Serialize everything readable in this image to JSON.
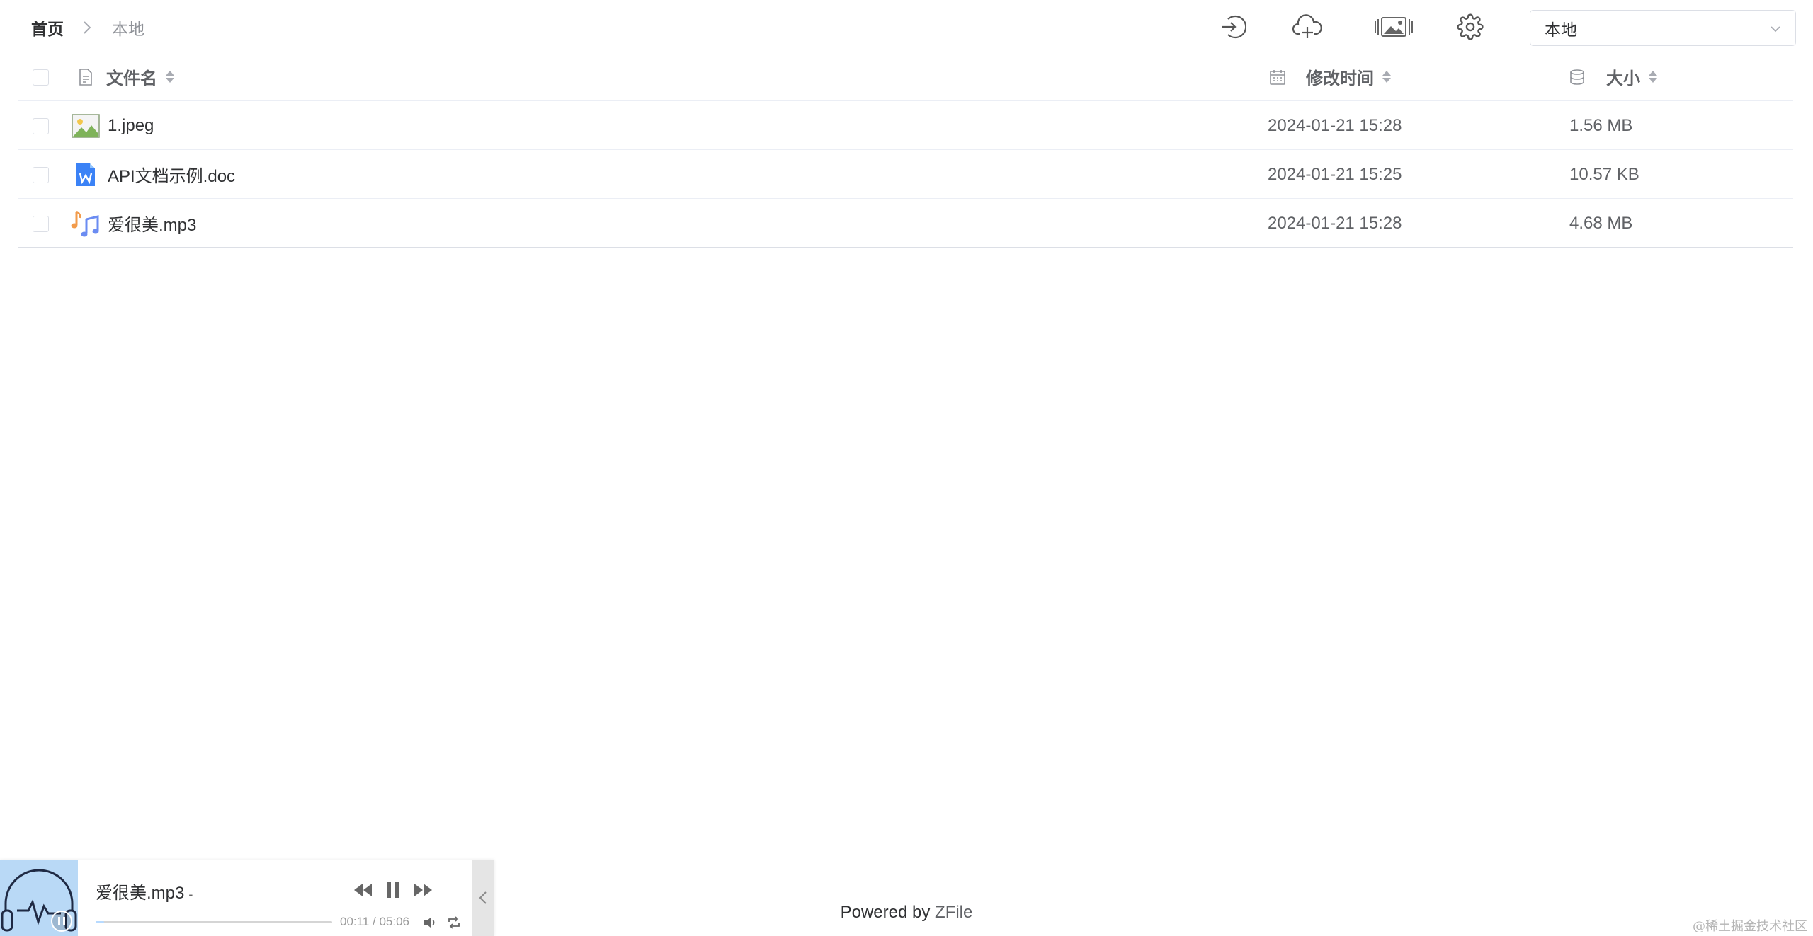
{
  "breadcrumb": {
    "home": "首页",
    "current": "本地"
  },
  "toolbar": {
    "icons": [
      "login-icon",
      "cloud-upload-icon",
      "gallery-icon",
      "gear-icon"
    ],
    "storage_value": "本地"
  },
  "table": {
    "columns": {
      "name": "文件名",
      "time": "修改时间",
      "size": "大小"
    },
    "rows": [
      {
        "name": "1.jpeg",
        "time": "2024-01-21 15:28",
        "size": "1.56 MB",
        "icon": "image-file-icon"
      },
      {
        "name": "API文档示例.doc",
        "time": "2024-01-21 15:25",
        "size": "10.57 KB",
        "icon": "word-file-icon"
      },
      {
        "name": "爱很美.mp3",
        "time": "2024-01-21 15:28",
        "size": "4.68 MB",
        "icon": "music-file-icon"
      }
    ]
  },
  "player": {
    "title": "爱很美.mp3",
    "artist": "-",
    "time": "00:11 / 05:06",
    "progress_fraction": 0.036
  },
  "footer": {
    "powered_prefix": "Powered by",
    "powered_link": "ZFile"
  },
  "watermark": "@稀土掘金技术社区",
  "colors": {
    "accent": "#409eff",
    "text": "#303133",
    "muted": "#909399",
    "cover": "#b9d9f6"
  }
}
